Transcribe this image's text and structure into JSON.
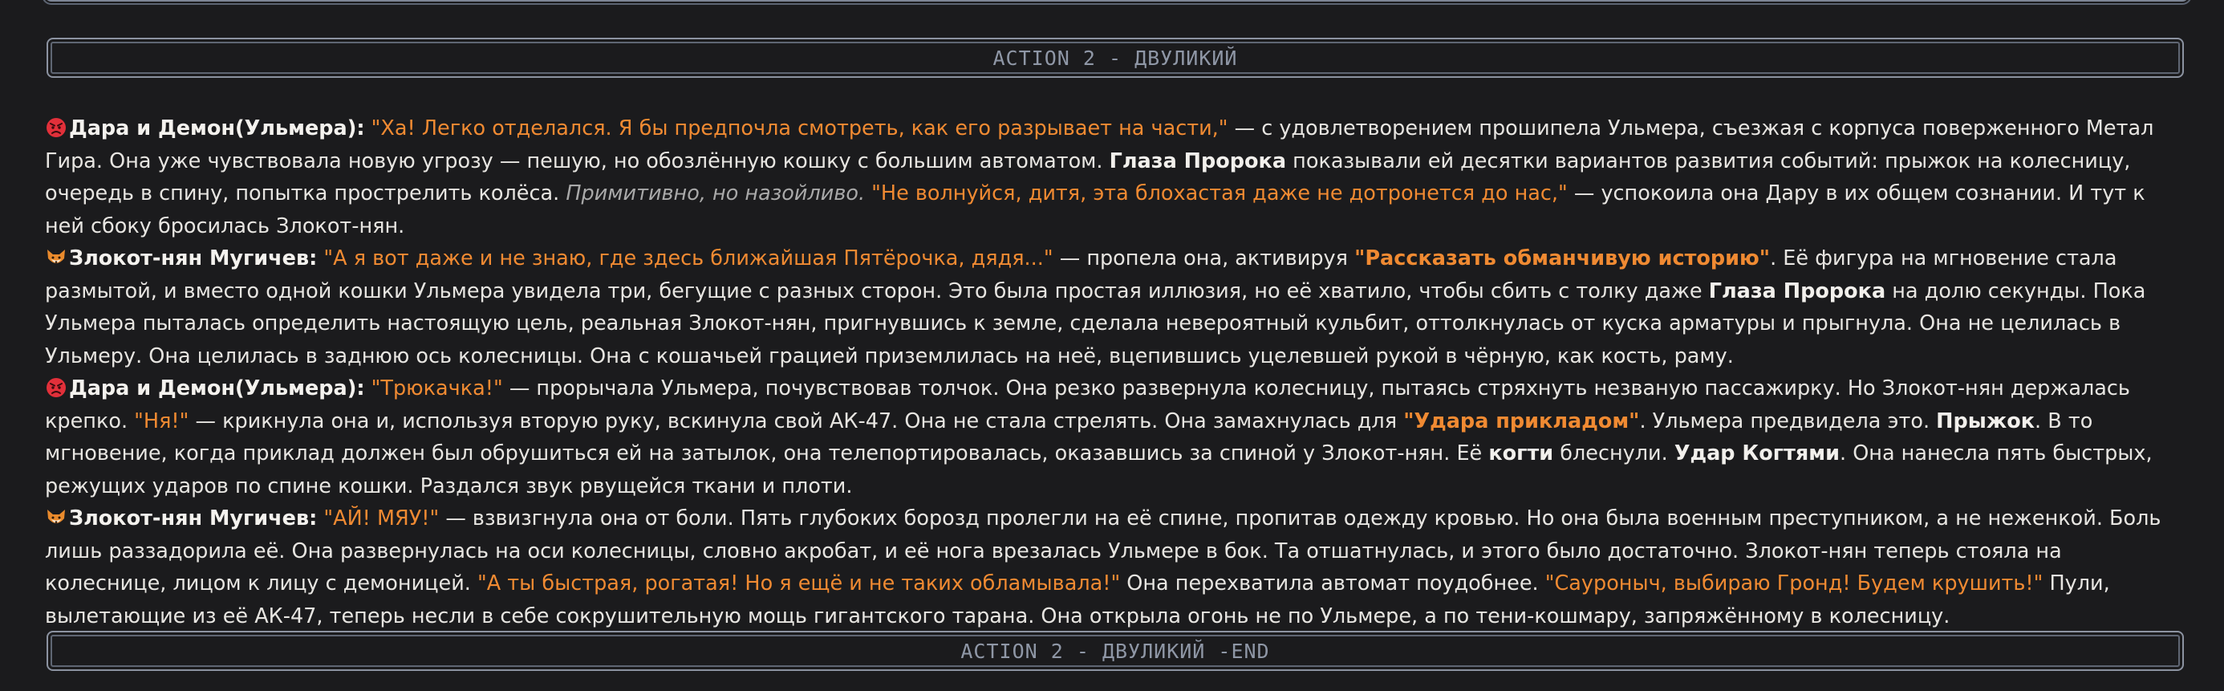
{
  "header": {
    "action_title": "ACTION 2 - ДВУЛИКИЙ"
  },
  "footer": {
    "action_end_title": "ACTION 2 - ДВУЛИКИЙ -END"
  },
  "colors": {
    "background": "#1b1b1d",
    "quote": "#f08a32",
    "text": "#e7e5e1",
    "thought": "#a9a9a9",
    "banner_border": "#8c93a1"
  },
  "paragraphs": [
    {
      "icon": "angry-face-icon",
      "speaker": "Дара и Демон(Ульмера):",
      "q1": "\"Ха! Легко отделался. Я бы предпочла смотреть, как его разрывает на части,\"",
      "t1": " — с удовлетворением прошипела Ульмера, съезжая с корпуса поверженного Метал Гира. Она уже чувствовала новую угрозу — пешую, но обозлённую кошку с большим автоматом. ",
      "b1": "Глаза Пророка",
      "t2": " показывали ей десятки вариантов развития событий: прыжок на колесницу, очередь в спину, попытка прострелить колёса. ",
      "i1": "Примитивно, но назойливо.",
      "t3": " ",
      "q2": "\"Не волнуйся, дитя, эта блохастая даже не дотронется до нас,\"",
      "t4": " — успокоила она Дару в их общем сознании. И тут к ней сбоку бросилась Злокот-нян."
    },
    {
      "icon": "fox-face-icon",
      "speaker": "Злокот-нян Мугичев:",
      "q1": "\"А я вот даже и не знаю, где здесь ближайшая Пятёрочка, дядя...\"",
      "t1": " — пропела она, активируя ",
      "bq1": "\"Рассказать обманчивую историю\"",
      "t2": ". Её фигура на мгновение стала размытой, и вместо одной кошки Ульмера увидела три, бегущие с разных сторон. Это была простая иллюзия, но её хватило, чтобы сбить с толку даже ",
      "b1": "Глаза Пророка",
      "t3": " на долю секунды. Пока Ульмера пыталась определить настоящую цель, реальная Злокот-нян, пригнувшись к земле, сделала невероятный кульбит, оттолкнулась от куска арматуры и прыгнула. Она не целилась в Ульмеру. Она целилась в заднюю ось колесницы. Она с кошачьей грацией приземлилась на неё, вцепившись уцелевшей рукой в чёрную, как кость, раму."
    },
    {
      "icon": "angry-face-icon",
      "speaker": "Дара и Демон(Ульмера):",
      "q1": "\"Трюкачка!\"",
      "t1": " — прорычала Ульмера, почувствовав толчок. Она резко развернула колесницу, пытаясь стряхнуть незваную пассажирку. Но Злокот-нян держалась крепко. ",
      "q2": "\"Ня!\"",
      "t2": " — крикнула она и, используя вторую руку, вскинула свой АК-47. Она не стала стрелять. Она замахнулась для ",
      "bq1": "\"Удара прикладом\"",
      "t3": ". Ульмера предвидела это. ",
      "b1": "Прыжок",
      "t4": ". В то мгновение, когда приклад должен был обрушиться ей на затылок, она телепортировалась, оказавшись за спиной у Злокот-нян. Её ",
      "b2": "когти",
      "t5": " блеснули. ",
      "b3": "Удар Когтями",
      "t6": ". Она нанесла пять быстрых, режущих ударов по спине кошки. Раздался звук рвущейся ткани и плоти."
    },
    {
      "icon": "fox-face-icon",
      "speaker": "Злокот-нян Мугичев:",
      "q1": "\"АЙ! МЯУ!\"",
      "t1": " — взвизгнула она от боли. Пять глубоких борозд пролегли на её спине, пропитав одежду кровью. Но она была военным преступником, а не неженкой. Боль лишь раззадорила её. Она развернулась на оси колесницы, словно акробат, и её нога врезалась Ульмере в бок. Та отшатнулась, и этого было достаточно. Злокот-нян теперь стояла на колеснице, лицом к лицу с демоницей. ",
      "q2": "\"А ты быстрая, рогатая! Но я ещё и не таких обламывала!\"",
      "t2": " Она перехватила автомат поудобнее. ",
      "q3": "\"Сауроныч, выбираю Гронд! Будем крушить!\"",
      "t3": " Пули, вылетающие из её АК-47, теперь несли в себе сокрушительную мощь гигантского тарана. Она открыла огонь не по Ульмере, а по тени-кошмару, запряжённому в колесницу."
    }
  ]
}
